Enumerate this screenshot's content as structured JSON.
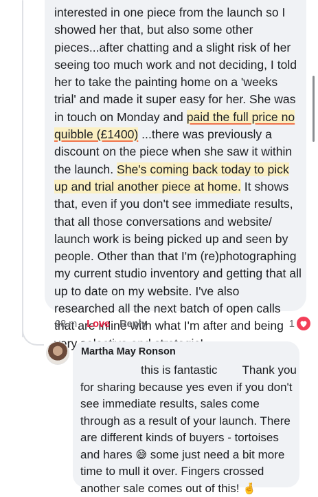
{
  "comment": {
    "text_before": "interested in one piece from the launch so I showed her that, but also some other pieces...after chatting and a slight risk of her seeing too much work and not deciding, I told her to take the painting home on a 'weeks trial' and made it super easy for her. She was in touch on Monday and ",
    "highlight_1": "paid the full price no quibble (£1400)",
    "text_middle": " ...there was previously a discount on the piece when she saw it within the launch. ",
    "highlight_2": "She's coming back today to pick up and trial another piece at home.",
    "text_after": " It shows that, even if you don't see immediate results, that all those conversations and website/ launch work is being picked up and seen by people. Other than that I'm (re)photographing my current studio inventory and getting that all up to date on my website. I've also researched all the next batch of open calls that are inline with what I'm after and being very selective and strategic!",
    "time": "28 m",
    "love_label": "Love",
    "reply_label": "Reply",
    "reaction_count": "1",
    "reaction_icon": "heart-icon",
    "love_color": "#e41e3f"
  },
  "reply": {
    "author": "Martha May Ronson",
    "line1_a": "this is fantastic",
    "line1_b": "Thank you",
    "text": "for sharing because yes even if you don't see immediate results, sales come through as a result of your launch. There are different kinds of buyers - tortoises and hares ",
    "emoji_1": "😅",
    "text_2": " some just need a bit more time to mull it over. Fingers crossed another sale comes out of this! ",
    "emoji_2": "🤞"
  }
}
